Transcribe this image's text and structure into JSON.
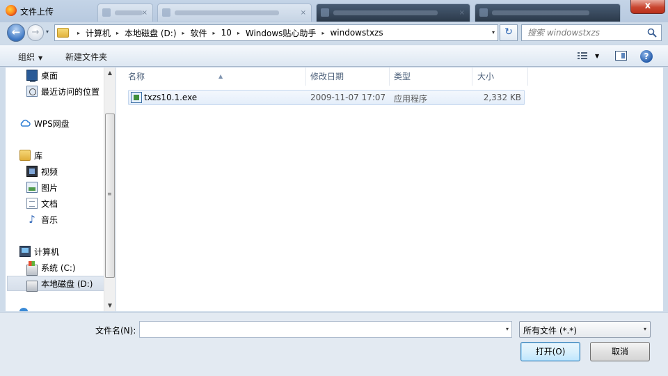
{
  "window": {
    "title": "文件上传",
    "close_label": "x"
  },
  "nav": {
    "back_label": "←",
    "forward_label": "→",
    "recent_label": "▾",
    "address": {
      "crumbs": [
        "计算机",
        "本地磁盘 (D:)",
        "软件",
        "10",
        "Windows贴心助手",
        "windowstxzs"
      ],
      "separator": "▸",
      "dropdown": "▾"
    },
    "refresh_label": "↻",
    "search_placeholder": "搜索 windowstxzs"
  },
  "toolbar": {
    "organize_label": "组织",
    "organize_caret": "▼",
    "new_folder_label": "新建文件夹",
    "view_caret": "▼",
    "help_label": "?"
  },
  "sidebar": {
    "items": [
      {
        "label": "桌面",
        "icon": "desktop-icon"
      },
      {
        "label": "最近访问的位置",
        "icon": "recent-places-icon"
      },
      {
        "label": "WPS网盘",
        "icon": "cloud-icon"
      },
      {
        "label": "库",
        "icon": "library-icon"
      },
      {
        "label": "视频",
        "icon": "video-icon"
      },
      {
        "label": "图片",
        "icon": "pictures-icon"
      },
      {
        "label": "文档",
        "icon": "documents-icon"
      },
      {
        "label": "音乐",
        "icon": "music-icon"
      },
      {
        "label": "计算机",
        "icon": "computer-icon"
      },
      {
        "label": "系统 (C:)",
        "icon": "system-drive-icon"
      },
      {
        "label": "本地磁盘 (D:)",
        "icon": "local-disk-icon",
        "selected": true
      }
    ],
    "scroll_up": "▲",
    "scroll_down": "▼",
    "scroll_grip": "≡"
  },
  "filelist": {
    "columns": [
      "名称",
      "修改日期",
      "类型",
      "大小"
    ],
    "sort_indicator": "▲",
    "rows": [
      {
        "name": "txzs10.1.exe",
        "modified": "2009-11-07 17:07",
        "type": "应用程序",
        "size": "2,332 KB"
      }
    ]
  },
  "footer": {
    "filename_label": "文件名(N):",
    "filename_value": "",
    "filename_dropdown": "▾",
    "filter_value": "所有文件 (*.*)",
    "filter_dropdown": "▾",
    "open_label": "打开(O)",
    "cancel_label": "取消"
  }
}
